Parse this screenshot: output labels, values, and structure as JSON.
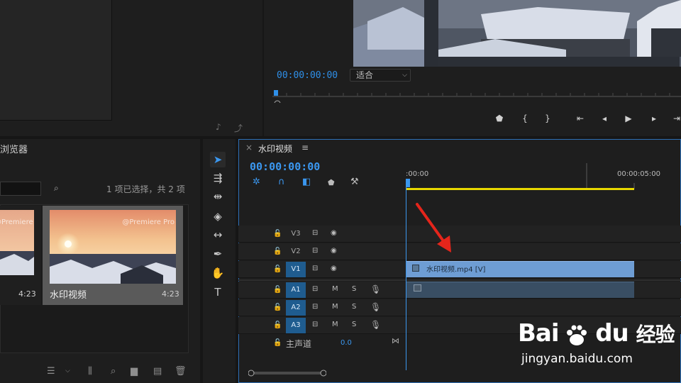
{
  "program_monitor": {
    "timecode": "00:00:00:00",
    "fit_label": "适合",
    "colors": {
      "accent_blue": "#2f8fe8"
    }
  },
  "project_panel": {
    "tab_label": "浏览器",
    "selection_count": "1 项已选择，共 2 项",
    "clips": [
      {
        "name": "",
        "watermark": "@Premiere Pro",
        "duration": "4:23"
      },
      {
        "name": "水印视频",
        "watermark": "@Premiere Pro",
        "duration": "4:23"
      }
    ]
  },
  "timeline": {
    "tab_label": "水印视频",
    "timecode": "00:00:00:00",
    "ruler_start": ":00:00",
    "ruler_mark": "00:00:05:00",
    "tracks": [
      {
        "name": "V3",
        "active": false
      },
      {
        "name": "V2",
        "active": false
      },
      {
        "name": "V1",
        "active": true
      },
      {
        "name": "A1",
        "active": true
      },
      {
        "name": "A2",
        "active": true
      },
      {
        "name": "A3",
        "active": true
      }
    ],
    "track_button_m": "M",
    "track_button_s": "S",
    "master_label": "主声道",
    "master_value": "0.0",
    "clip_label": "水印视频.mp4 [V]",
    "work_area_color": "#e8d800",
    "clip_video_color": "#6e9dd4",
    "clip_audio_color": "#394e63"
  },
  "watermark": {
    "brand": "Bai du 经验",
    "brand_left": "Bai",
    "brand_right": "du",
    "brand_cn": "经验",
    "url": "jingyan.baidu.com"
  },
  "annotation": {
    "arrow_color": "#e5251b"
  }
}
